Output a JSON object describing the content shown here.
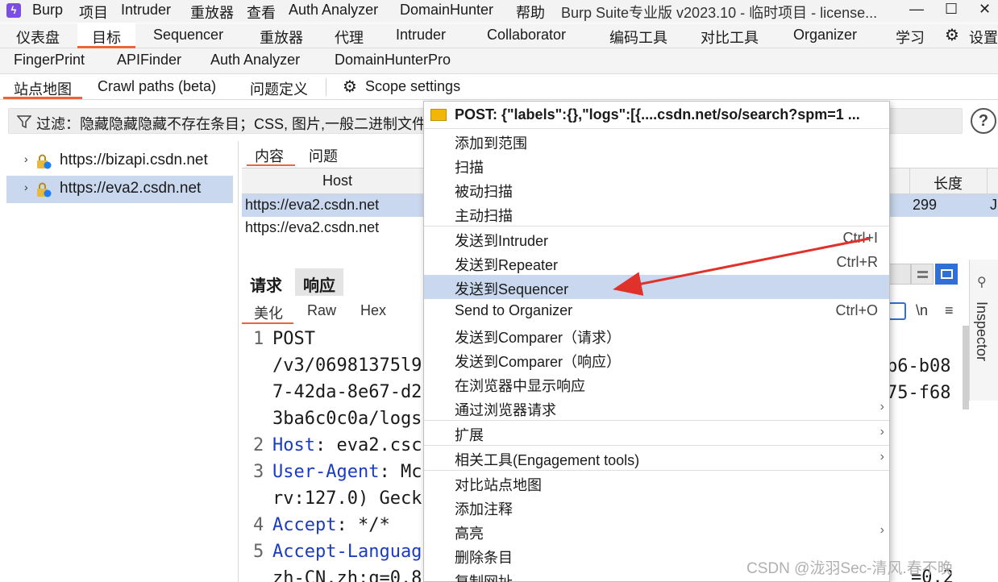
{
  "titlebar": {
    "menu": [
      "Burp",
      "项目",
      "Intruder",
      "重放器",
      "查看",
      "Auth Analyzer",
      "DomainHunter",
      "帮助"
    ],
    "window_title": "Burp Suite专业版  v2023.10 - 临时项目 - license...",
    "controls": [
      "—",
      "☐",
      "✕"
    ]
  },
  "tabs_row1": [
    "仪表盘",
    "目标",
    "Sequencer",
    "重放器",
    "代理",
    "Intruder",
    "Collaborator",
    "编码工具",
    "对比工具",
    "Organizer",
    "学习",
    "设置"
  ],
  "tabs_row2": [
    "FingerPrint",
    "APIFinder",
    "Auth Analyzer",
    "DomainHunterPro"
  ],
  "subtabs": [
    "站点地图",
    "Crawl paths (beta)",
    "问题定义",
    "Scope settings"
  ],
  "filter": {
    "text": "过滤：隐藏隐藏隐藏不存在条目；CSS, 图片,一般二进制文件;"
  },
  "sitetree": {
    "items": [
      {
        "url": "https://bizapi.csdn.net"
      },
      {
        "url": "https://eva2.csdn.net"
      }
    ]
  },
  "content_tabs": [
    "内容",
    "问题"
  ],
  "table": {
    "headers": [
      "Host",
      "长度"
    ],
    "rows": [
      {
        "host": "https://eva2.csdn.net",
        "length": "299",
        "extra": "JS"
      },
      {
        "host": "https://eva2.csdn.net",
        "length": "",
        "extra": ""
      }
    ]
  },
  "request": {
    "tabs": [
      "请求",
      "响应"
    ],
    "subtabs": [
      "美化",
      "Raw",
      "Hex"
    ],
    "toolbar_glyphs": [
      "\\n",
      "≡"
    ],
    "lines": [
      {
        "n": "1",
        "parts": [
          {
            "t": "POST",
            "c": ""
          }
        ]
      },
      {
        "n": "",
        "parts": [
          {
            "t": "/v3/06981375l9",
            "c": ""
          }
        ]
      },
      {
        "n": "",
        "parts": [
          {
            "t": "7-42da-8e67-d2",
            "c": ""
          }
        ]
      },
      {
        "n": "",
        "parts": [
          {
            "t": "3ba6c0c0a/logs",
            "c": ""
          }
        ]
      },
      {
        "n": "2",
        "parts": [
          {
            "t": "Host",
            "c": "hdr"
          },
          {
            "t": ": eva2.csc",
            "c": ""
          }
        ]
      },
      {
        "n": "3",
        "parts": [
          {
            "t": "User-Agent",
            "c": "hdr"
          },
          {
            "t": ": Mc",
            "c": ""
          }
        ]
      },
      {
        "n": "",
        "parts": [
          {
            "t": "rv:127.0) Geck",
            "c": ""
          }
        ]
      },
      {
        "n": "4",
        "parts": [
          {
            "t": "Accept",
            "c": "hdr"
          },
          {
            "t": ": */*",
            "c": ""
          }
        ]
      },
      {
        "n": "5",
        "parts": [
          {
            "t": "Accept-Languag",
            "c": "hdr"
          }
        ]
      },
      {
        "n": "",
        "parts": [
          {
            "t": "zh-CN,zh;q=0.8",
            "c": ""
          }
        ]
      }
    ],
    "right_fragments": [
      "b6-b08",
      "75-f68"
    ],
    "bottom_right_fragment": "=0.2"
  },
  "inspector": {
    "label": "Inspector"
  },
  "context_menu": {
    "header": "POST: {\"labels\":{},\"logs\":[{....csdn.net/so/search?spm=1 ...",
    "items": [
      {
        "label": "添加到范围",
        "shortcut": "",
        "submenu": false,
        "highlight": false,
        "sep_before": false
      },
      {
        "label": "扫描",
        "shortcut": "",
        "submenu": false,
        "highlight": false,
        "sep_before": false
      },
      {
        "label": "被动扫描",
        "shortcut": "",
        "submenu": false,
        "highlight": false,
        "sep_before": false
      },
      {
        "label": "主动扫描",
        "shortcut": "",
        "submenu": false,
        "highlight": false,
        "sep_before": false
      },
      {
        "label": "发送到Intruder",
        "shortcut": "Ctrl+I",
        "submenu": false,
        "highlight": false,
        "sep_before": true
      },
      {
        "label": "发送到Repeater",
        "shortcut": "Ctrl+R",
        "submenu": false,
        "highlight": false,
        "sep_before": false
      },
      {
        "label": "发送到Sequencer",
        "shortcut": "",
        "submenu": false,
        "highlight": true,
        "sep_before": false
      },
      {
        "label": "Send to Organizer",
        "shortcut": "Ctrl+O",
        "submenu": false,
        "highlight": false,
        "sep_before": false
      },
      {
        "label": "发送到Comparer（请求）",
        "shortcut": "",
        "submenu": false,
        "highlight": false,
        "sep_before": false
      },
      {
        "label": "发送到Comparer（响应）",
        "shortcut": "",
        "submenu": false,
        "highlight": false,
        "sep_before": false
      },
      {
        "label": "在浏览器中显示响应",
        "shortcut": "",
        "submenu": false,
        "highlight": false,
        "sep_before": false
      },
      {
        "label": "通过浏览器请求",
        "shortcut": "",
        "submenu": true,
        "highlight": false,
        "sep_before": false
      },
      {
        "label": "扩展",
        "shortcut": "",
        "submenu": true,
        "highlight": false,
        "sep_before": true
      },
      {
        "label": "相关工具(Engagement tools)",
        "shortcut": "",
        "submenu": true,
        "highlight": false,
        "sep_before": true
      },
      {
        "label": "对比站点地图",
        "shortcut": "",
        "submenu": false,
        "highlight": false,
        "sep_before": true
      },
      {
        "label": "添加注释",
        "shortcut": "",
        "submenu": false,
        "highlight": false,
        "sep_before": false
      },
      {
        "label": "高亮",
        "shortcut": "",
        "submenu": true,
        "highlight": false,
        "sep_before": false
      },
      {
        "label": "删除条目",
        "shortcut": "",
        "submenu": false,
        "highlight": false,
        "sep_before": false
      },
      {
        "label": "复制网址",
        "shortcut": "",
        "submenu": false,
        "highlight": false,
        "sep_before": false
      }
    ]
  },
  "watermark": "CSDN @泷羽Sec-清风.春不晚",
  "colors": {
    "accent": "#e8663a",
    "selection": "#c9d8ee",
    "arrow": "#e0312b",
    "header_name": "#1a3cc4"
  }
}
